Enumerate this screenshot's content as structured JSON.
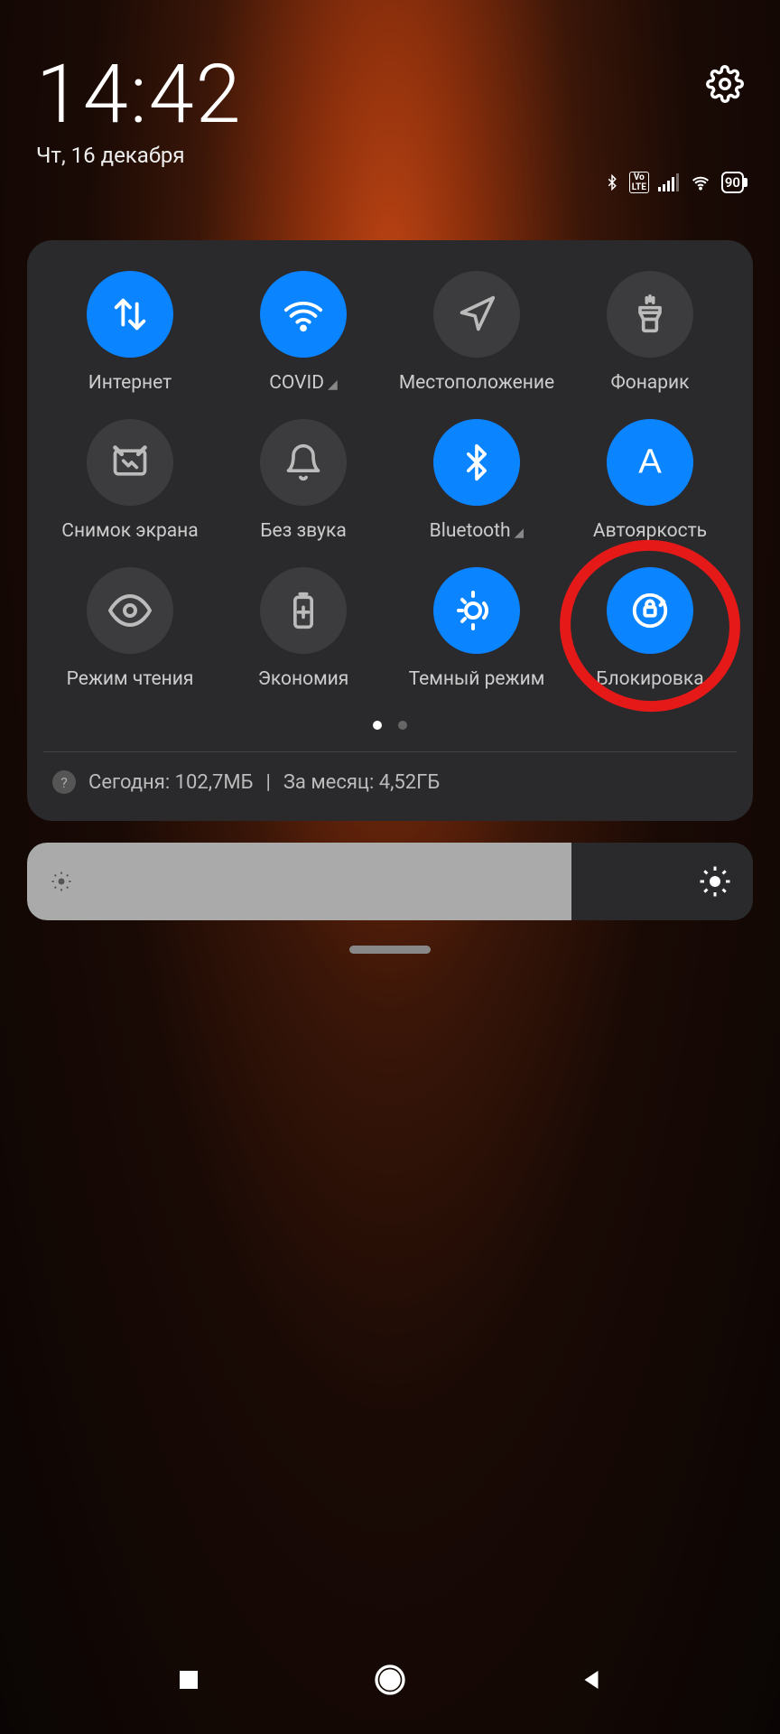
{
  "header": {
    "time": "14:42",
    "date": "Чт, 16 декабря"
  },
  "status": {
    "battery_pct": "90",
    "volte_label": "Vo\nLTE"
  },
  "tiles": [
    {
      "label": "Интернет",
      "active": true,
      "icon": "data-arrows",
      "expandable": false
    },
    {
      "label": "COVID",
      "active": true,
      "icon": "wifi",
      "expandable": true
    },
    {
      "label": "Местоположение",
      "active": false,
      "icon": "location",
      "expandable": false
    },
    {
      "label": "Фонарик",
      "active": false,
      "icon": "flashlight",
      "expandable": false
    },
    {
      "label": "Снимок экрана",
      "active": false,
      "icon": "screenshot",
      "expandable": false
    },
    {
      "label": "Без звука",
      "active": false,
      "icon": "bell",
      "expandable": false
    },
    {
      "label": "Bluetooth",
      "active": true,
      "icon": "bluetooth",
      "expandable": true
    },
    {
      "label": "Автояркость",
      "active": true,
      "icon": "letter-a",
      "expandable": false
    },
    {
      "label": "Режим чтения",
      "active": false,
      "icon": "eye",
      "expandable": false
    },
    {
      "label": "Экономия",
      "active": false,
      "icon": "battery-plus",
      "expandable": false
    },
    {
      "label": "Темный режим",
      "active": true,
      "icon": "dark-mode",
      "expandable": false
    },
    {
      "label": "Блокировка",
      "active": true,
      "icon": "rotation-lock",
      "expandable": false,
      "annotated": true
    }
  ],
  "data_usage": {
    "today": "Сегодня: 102,7МБ",
    "separator": "|",
    "month": "За месяц: 4,52ГБ"
  },
  "brightness_pct": 75
}
